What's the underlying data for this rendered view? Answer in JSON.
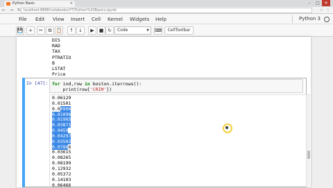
{
  "browser": {
    "tab_title": "Python Basic",
    "url": "localhost:8888/notebooks/YT/Python%20Basics.ipynb",
    "nav_glyphs": "← → ↻",
    "window_buttons": [
      "–",
      "□",
      "✕"
    ]
  },
  "menu": {
    "items": [
      "File",
      "Edit",
      "View",
      "Insert",
      "Cell",
      "Kernel",
      "Widgets",
      "Help"
    ],
    "kernel": "Python 3"
  },
  "toolbar": {
    "buttons": [
      "💾",
      "+",
      "✂",
      "⧉",
      "📋",
      "↑",
      "↓",
      "▶",
      "■",
      "↻"
    ],
    "cell_type": "Code",
    "celltoolbar": "CellToolbar"
  },
  "previous_output": [
    "DIS",
    "RAD",
    "TAX",
    "PTRATIO",
    "B",
    "LSTAT",
    "Price"
  ],
  "cell": {
    "prompt": "In [47]:",
    "code_line1_kw1": "for",
    "code_line1_mid": " ind,row ",
    "code_line1_kw2": "in",
    "code_line1_rest": " boston.iterrows():",
    "code_line2_pre": "    print(row[",
    "code_line2_str": "'CRIM'",
    "code_line2_post": "])"
  },
  "output": {
    "lines": [
      {
        "text": "0.06129",
        "highlight": false
      },
      {
        "text": "0.01501",
        "highlight": false
      },
      {
        "text": "0.00906",
        "highlight": true,
        "split": 3
      },
      {
        "text": "0.01096",
        "highlight": true
      },
      {
        "text": "0.01965",
        "highlight": true
      },
      {
        "text": "0.03871",
        "highlight": true
      },
      {
        "text": "0.0459",
        "highlight": true
      },
      {
        "text": "0.04297",
        "highlight": true
      },
      {
        "text": "0.03502",
        "highlight": true
      },
      {
        "text": "0.07886",
        "highlight": true,
        "partial": 6
      },
      {
        "text": "0.03615",
        "highlight": false
      },
      {
        "text": "0.08265",
        "highlight": false
      },
      {
        "text": "0.08199",
        "highlight": false
      },
      {
        "text": "0.12932",
        "highlight": false
      },
      {
        "text": "0.05372",
        "highlight": false
      },
      {
        "text": "0.14103",
        "highlight": false
      },
      {
        "text": "0.06466",
        "highlight": false
      }
    ]
  }
}
